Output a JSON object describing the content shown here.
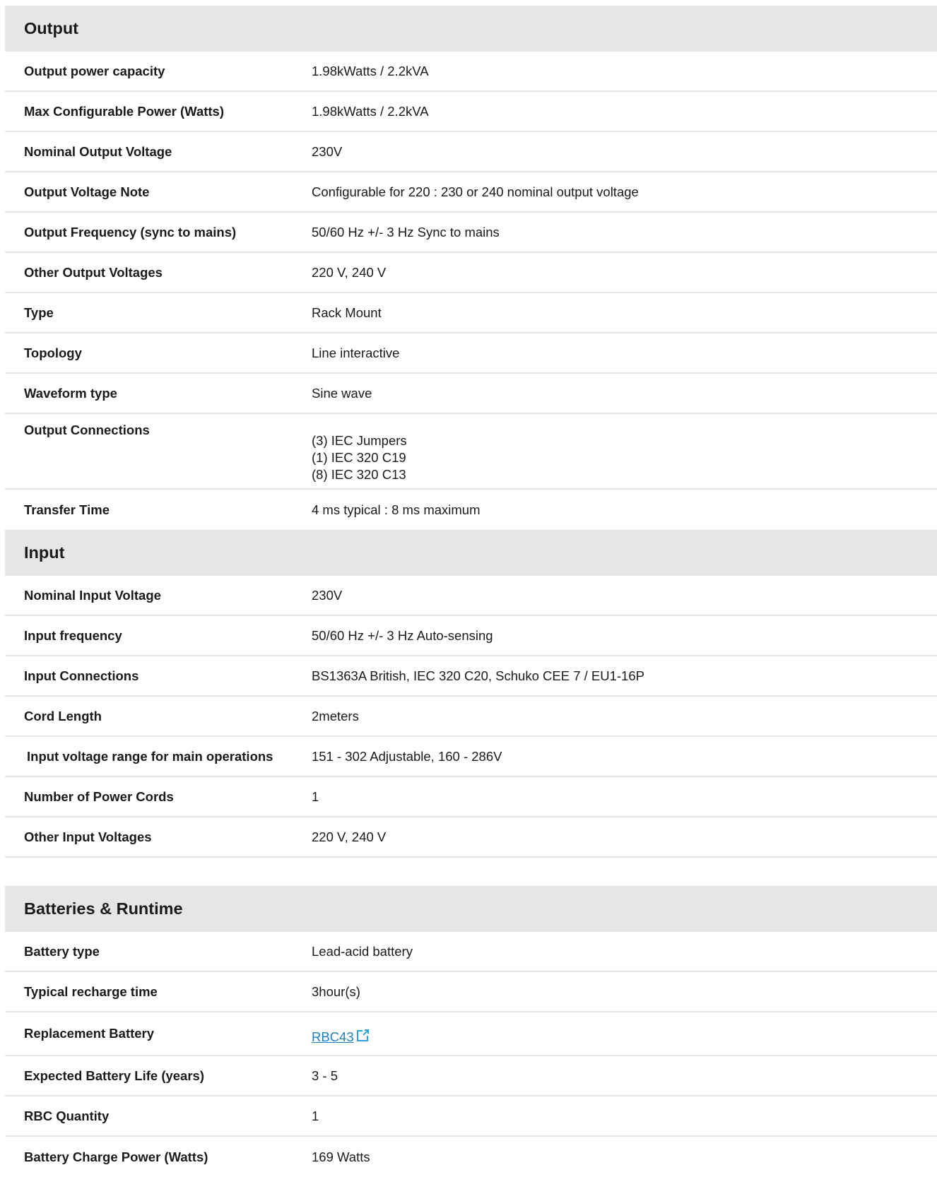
{
  "sections": [
    {
      "title": "Output",
      "rows": [
        {
          "label": "Output power capacity",
          "value": "1.98kWatts / 2.2kVA"
        },
        {
          "label": "Max Configurable Power (Watts)",
          "value": "1.98kWatts / 2.2kVA"
        },
        {
          "label": "Nominal Output Voltage",
          "value": "230V"
        },
        {
          "label": "Output Voltage Note",
          "value": "Configurable for 220 : 230 or 240 nominal output voltage"
        },
        {
          "label": "Output Frequency (sync to mains)",
          "value": "50/60 Hz +/- 3 Hz Sync to mains"
        },
        {
          "label": "Other Output Voltages",
          "value": "220 V, 240 V"
        },
        {
          "label": "Type",
          "value": "Rack Mount"
        },
        {
          "label": "Topology",
          "value": "Line interactive"
        },
        {
          "label": "Waveform type",
          "value": "Sine wave"
        },
        {
          "label": "Output Connections",
          "values": [
            "(3) IEC Jumpers",
            "(1) IEC 320 C19",
            "(8) IEC 320 C13"
          ]
        },
        {
          "label": "Transfer Time",
          "value": "4 ms typical : 8 ms maximum"
        }
      ]
    },
    {
      "title": "Input",
      "rows": [
        {
          "label": "Nominal Input Voltage",
          "value": "230V"
        },
        {
          "label": "Input frequency",
          "value": "50/60 Hz +/- 3 Hz Auto-sensing"
        },
        {
          "label": "Input Connections",
          "value": "BS1363A British, IEC 320 C20, Schuko CEE 7 / EU1-16P"
        },
        {
          "label": "Cord Length",
          "value": "2meters"
        },
        {
          "label": "Input voltage range for main operations",
          "value": "151 - 302 Adjustable, 160 - 286V"
        },
        {
          "label": "Number of Power Cords",
          "value": "1"
        },
        {
          "label": "Other Input Voltages",
          "value": "220 V, 240 V"
        }
      ]
    },
    {
      "title": "Batteries & Runtime",
      "rows": [
        {
          "label": "Battery type",
          "value": "Lead-acid battery"
        },
        {
          "label": "Typical recharge time",
          "value": "3hour(s)"
        },
        {
          "label": "Replacement Battery",
          "value": "RBC43",
          "icon": "external-link-icon"
        },
        {
          "label": "Expected Battery Life (years)",
          "value": "3 - 5"
        },
        {
          "label": "RBC Quantity",
          "value": "1"
        },
        {
          "label": "Battery Charge Power (Watts)",
          "value": "169 Watts"
        }
      ]
    }
  ],
  "colors": {
    "header_bg": "#e6e6e6",
    "divider": "#e6e6e6",
    "link": "#1c7fbf"
  }
}
